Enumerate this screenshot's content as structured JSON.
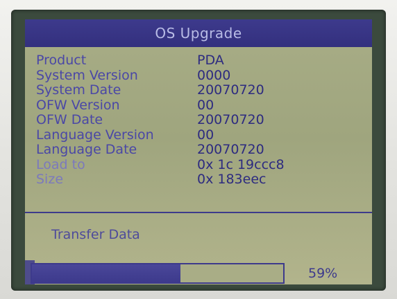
{
  "window": {
    "title": "OS Upgrade"
  },
  "info": {
    "rows": [
      {
        "label": "Product",
        "value": "PDA"
      },
      {
        "label": "System Version",
        "value": "0000"
      },
      {
        "label": "System Date",
        "value": "20070720"
      },
      {
        "label": "OFW Version",
        "value": "00"
      },
      {
        "label": "OFW Date",
        "value": "20070720"
      },
      {
        "label": "Language Version",
        "value": "00"
      },
      {
        "label": "Language Date",
        "value": "20070720"
      },
      {
        "label": "Load to",
        "value": "0x 1c 19ccc8"
      },
      {
        "label": "Size",
        "value": "0x 183eec"
      }
    ]
  },
  "status": {
    "text": "Transfer Data"
  },
  "progress": {
    "percent_label": "59%",
    "value": 0.59
  },
  "colors": {
    "screen_bg": "#a8ad86",
    "titlebar_bg": "#3d3a8c",
    "text": "#4a47a6",
    "accent": "#3d3a8c"
  }
}
